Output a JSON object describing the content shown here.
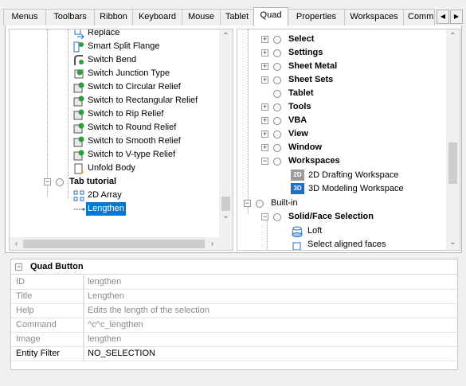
{
  "tabs": [
    "Menus",
    "Toolbars",
    "Ribbon",
    "Keyboard",
    "Mouse",
    "Tablet",
    "Quad",
    "Properties",
    "Workspaces",
    "Comm"
  ],
  "active_tab": "Quad",
  "left_tree": {
    "items": [
      "Replace",
      "Smart Split Flange",
      "Switch Bend",
      "Switch Junction Type",
      "Switch to Circular Relief",
      "Switch to Rectangular Relief",
      "Switch to Rip Relief",
      "Switch to Round Relief",
      "Switch to Smooth Relief",
      "Switch to V-type Relief",
      "Unfold Body"
    ],
    "group": "Tab tutorial",
    "children": [
      "2D Array",
      "Lengthen"
    ],
    "selected": "Lengthen"
  },
  "right_tree": {
    "groups": [
      "Select",
      "Settings",
      "Sheet Metal",
      "Sheet Sets",
      "Tablet",
      "Tools",
      "VBA",
      "View",
      "Window",
      "Workspaces"
    ],
    "workspaces": [
      {
        "badge": "2D",
        "label": "2D Drafting Workspace"
      },
      {
        "badge": "3D",
        "label": "3D Modeling Workspace"
      }
    ],
    "builtin": "Built-in",
    "solid_face": "Solid/Face Selection",
    "solid_children": [
      "Loft",
      "Select aligned faces"
    ]
  },
  "props": {
    "header": "Quad Button",
    "rows": [
      {
        "name": "ID",
        "value": "lengthen",
        "active": false
      },
      {
        "name": "Title",
        "value": "Lengthen",
        "active": false
      },
      {
        "name": "Help",
        "value": "Edits the length of the selection",
        "active": false
      },
      {
        "name": "Command",
        "value": "^c^c_lengthen",
        "active": false
      },
      {
        "name": "Image",
        "value": "lengthen",
        "active": false
      },
      {
        "name": "Entity Filter",
        "value": "NO_SELECTION",
        "active": true
      }
    ]
  },
  "icons": {
    "tab_prev": "chevron-left-icon",
    "tab_next": "chevron-right-icon"
  },
  "colors": {
    "selection": "#0078d7",
    "accent_blue": "#1f6fc4",
    "icon_green": "#2e9d3a",
    "thumb": "#cdcdcd"
  }
}
